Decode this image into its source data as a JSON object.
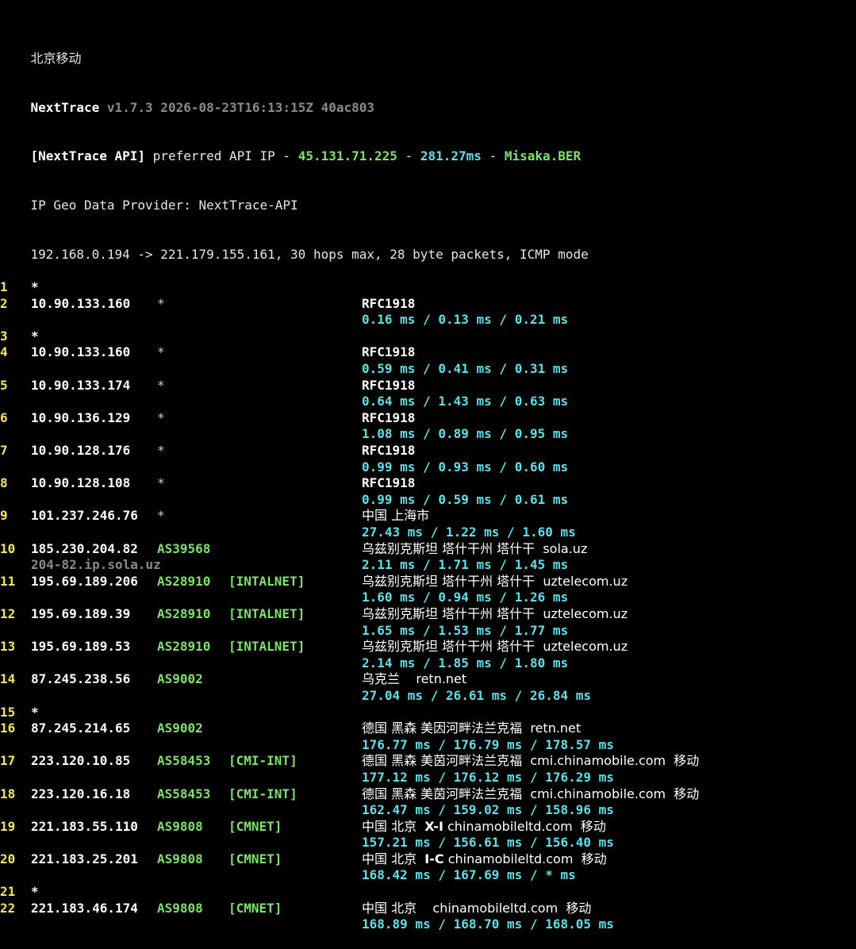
{
  "window_title": "北京移动",
  "header": {
    "app_name": "NextTrace",
    "version": "v1.7.3 2026-08-23T16:13:15Z 40ac803",
    "api_tag": "[NextTrace API]",
    "api_text": "preferred API IP -",
    "api_ip": "45.131.71.225",
    "api_sep1": "-",
    "api_latency": "281.27ms",
    "api_sep2": "-",
    "api_node": "Misaka.BER",
    "geo_provider": "IP Geo Data Provider: NextTrace-API",
    "trace_info": "192.168.0.194 -> 221.179.155.161, 30 hops max, 28 byte packets, ICMP mode"
  },
  "hops": [
    {
      "num": "1",
      "ip": "*"
    },
    {
      "num": "2",
      "ip": "10.90.133.160",
      "asn": "*",
      "geo": "RFC1918",
      "rtt": [
        "0.16 ms",
        "0.13 ms",
        "0.21 ms"
      ]
    },
    {
      "num": "3",
      "ip": "*"
    },
    {
      "num": "4",
      "ip": "10.90.133.160",
      "asn": "*",
      "geo": "RFC1918",
      "rtt": [
        "0.59 ms",
        "0.41 ms",
        "0.31 ms"
      ]
    },
    {
      "num": "5",
      "ip": "10.90.133.174",
      "asn": "*",
      "geo": "RFC1918",
      "rtt": [
        "0.64 ms",
        "1.43 ms",
        "0.63 ms"
      ]
    },
    {
      "num": "6",
      "ip": "10.90.136.129",
      "asn": "*",
      "geo": "RFC1918",
      "rtt": [
        "1.08 ms",
        "0.89 ms",
        "0.95 ms"
      ]
    },
    {
      "num": "7",
      "ip": "10.90.128.176",
      "asn": "*",
      "geo": "RFC1918",
      "rtt": [
        "0.99 ms",
        "0.93 ms",
        "0.60 ms"
      ]
    },
    {
      "num": "8",
      "ip": "10.90.128.108",
      "asn": "*",
      "geo": "RFC1918",
      "rtt": [
        "0.99 ms",
        "0.59 ms",
        "0.61 ms"
      ]
    },
    {
      "num": "9",
      "ip": "101.237.246.76",
      "asn": "*",
      "geo": "中国 上海市",
      "rtt": [
        "27.43 ms",
        "1.22 ms",
        "1.60 ms"
      ]
    },
    {
      "num": "10",
      "ip": "185.230.204.82",
      "asn": "AS39568",
      "geo": "乌兹别克斯坦 塔什干州 塔什干  sola.uz",
      "rdns": "204-82.ip.sola.uz",
      "rtt": [
        "2.11 ms",
        "1.71 ms",
        "1.45 ms"
      ]
    },
    {
      "num": "11",
      "ip": "195.69.189.206",
      "asn": "AS28910",
      "tag": "[INTALNET]",
      "geo": "乌兹别克斯坦 塔什干州 塔什干  uztelecom.uz",
      "rtt": [
        "1.60 ms",
        "0.94 ms",
        "1.26 ms"
      ]
    },
    {
      "num": "12",
      "ip": "195.69.189.39",
      "asn": "AS28910",
      "tag": "[INTALNET]",
      "geo": "乌兹别克斯坦 塔什干州 塔什干  uztelecom.uz",
      "rtt": [
        "1.65 ms",
        "1.53 ms",
        "1.77 ms"
      ]
    },
    {
      "num": "13",
      "ip": "195.69.189.53",
      "asn": "AS28910",
      "tag": "[INTALNET]",
      "geo": "乌兹别克斯坦 塔什干州 塔什干  uztelecom.uz",
      "rtt": [
        "2.14 ms",
        "1.85 ms",
        "1.80 ms"
      ]
    },
    {
      "num": "14",
      "ip": "87.245.238.56",
      "asn": "AS9002",
      "geo": "乌克兰    retn.net",
      "rtt": [
        "27.04 ms",
        "26.61 ms",
        "26.84 ms"
      ]
    },
    {
      "num": "15",
      "ip": "*"
    },
    {
      "num": "16",
      "ip": "87.245.214.65",
      "asn": "AS9002",
      "geo": "德国 黑森 美因河畔法兰克福  retn.net",
      "rtt": [
        "176.77 ms",
        "176.79 ms",
        "178.57 ms"
      ]
    },
    {
      "num": "17",
      "ip": "223.120.10.85",
      "asn": "AS58453",
      "tag": "[CMI-INT]",
      "geo": "德国 黑森 美茵河畔法兰克福  cmi.chinamobile.com  移动",
      "rtt": [
        "177.12 ms",
        "176.12 ms",
        "176.29 ms"
      ]
    },
    {
      "num": "18",
      "ip": "223.120.16.18",
      "asn": "AS58453",
      "tag": "[CMI-INT]",
      "geo": "德国 黑森 美茵河畔法兰克福  cmi.chinamobile.com  移动",
      "rtt": [
        "162.47 ms",
        "159.02 ms",
        "158.96 ms"
      ]
    },
    {
      "num": "19",
      "ip": "221.183.55.110",
      "asn": "AS9808",
      "tag": "[CMNET]",
      "geo_pre": "中国 北京  ",
      "geo_bold": "X-I",
      "geo_post": " chinamobileltd.com  移动",
      "rtt": [
        "157.21 ms",
        "156.61 ms",
        "156.40 ms"
      ]
    },
    {
      "num": "20",
      "ip": "221.183.25.201",
      "asn": "AS9808",
      "tag": "[CMNET]",
      "geo_pre": "中国 北京  ",
      "geo_bold": "I-C",
      "geo_post": " chinamobileltd.com  移动",
      "rtt": [
        "168.42 ms",
        "167.69 ms",
        "* ms"
      ]
    },
    {
      "num": "21",
      "ip": "*"
    },
    {
      "num": "22",
      "ip": "221.183.46.174",
      "asn": "AS9808",
      "tag": "[CMNET]",
      "geo": "中国 北京    chinamobileltd.com  移动",
      "rtt": [
        "168.89 ms",
        "168.70 ms",
        "168.05 ms"
      ]
    }
  ],
  "colors": {
    "background": "#000000",
    "hop_number": "#f2e85a",
    "asn": "#7ee26a",
    "rtt": "#5fe0e8",
    "dim": "#8a8a8a",
    "text": "#ffffff"
  }
}
